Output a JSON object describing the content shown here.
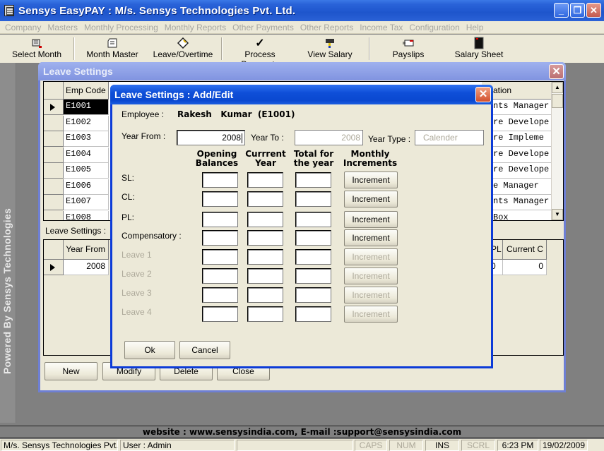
{
  "app": {
    "title": "Sensys EasyPAY : M/s. Sensys Technologies Pvt. Ltd.",
    "window_controls": {
      "minimize": "_",
      "restore": "❐",
      "close": "✕"
    }
  },
  "menu": [
    "Company",
    "Masters",
    "Monthly Processing",
    "Monthly Reports",
    "Other Payments",
    "Other Reports",
    "Income Tax",
    "Configuration",
    "Help"
  ],
  "toolbar": [
    {
      "label": "Select Month",
      "icon": "calendar-flag-icon"
    },
    {
      "label": "Month Master",
      "icon": "notepad-icon"
    },
    {
      "label": "Leave/Overtime",
      "icon": "diamond-tag-icon"
    },
    {
      "label": "Process Payments",
      "icon": "checkmark-icon"
    },
    {
      "label": "View Salary",
      "icon": "projector-icon"
    },
    {
      "label": "Payslips",
      "icon": "payslip-icon"
    },
    {
      "label": "Salary Sheet",
      "icon": "sheet-icon"
    }
  ],
  "banner": "Powered By Sensys Technologies",
  "leave_settings_window": {
    "title": "Leave Settings",
    "close": "✕",
    "employee_grid": {
      "columns": [
        "Emp Code",
        "Designation"
      ],
      "designation_header_visible": "ation",
      "rows": [
        {
          "code": "E1001",
          "designation": "nts Manager",
          "selected": true
        },
        {
          "code": "E1002",
          "designation": "re Develope"
        },
        {
          "code": "E1003",
          "designation": "re Impleme"
        },
        {
          "code": "E1004",
          "designation": "re Develope"
        },
        {
          "code": "E1005",
          "designation": "re Develope"
        },
        {
          "code": "E1006",
          "designation": "e Manager"
        },
        {
          "code": "E1007",
          "designation": "nts Manager"
        },
        {
          "code": "E1008",
          "designation": "Box"
        }
      ]
    },
    "leave_settings_label": "Leave Settings :",
    "settings_grid": {
      "columns": [
        "Year From",
        "PL",
        "Current C"
      ],
      "rows": [
        {
          "year_from": "2008",
          "pl": "0",
          "current": "0"
        }
      ]
    },
    "buttons": [
      {
        "label": "New",
        "accel": "N"
      },
      {
        "label": "Modify",
        "accel": "M"
      },
      {
        "label": "Delete",
        "accel": "D"
      },
      {
        "label": "Close",
        "accel": "C"
      }
    ]
  },
  "dialog": {
    "title": "Leave Settings : Add/Edit",
    "close": "✕",
    "employee_label": "Employee :",
    "employee_name": "Rakesh   Kumar  (E1001)",
    "year_from_label": "Year From :",
    "year_from_value": "2008",
    "year_to_label": "Year To :",
    "year_to_value": "2008",
    "year_type_label": "Year Type :",
    "year_type_value": "Calender",
    "col_headers": [
      {
        "line1": "Opening",
        "line2": "Balances"
      },
      {
        "line1": "Currrent",
        "line2": "Year"
      },
      {
        "line1": "Total for",
        "line2": "the year"
      },
      {
        "line1": "Monthly",
        "line2": "Increments"
      }
    ],
    "rows": [
      {
        "label": "SL:",
        "enabled": true,
        "opening": "",
        "current": "",
        "total": "",
        "button": "Increment"
      },
      {
        "label": "CL:",
        "enabled": true,
        "opening": "",
        "current": "",
        "total": "",
        "button": "Increment"
      },
      {
        "label": "PL:",
        "enabled": true,
        "opening": "",
        "current": "",
        "total": "",
        "button": "Increment"
      },
      {
        "label": "Compensatory :",
        "enabled": true,
        "opening": "",
        "current": "",
        "total": "",
        "button": "Increment"
      },
      {
        "label": "Leave 1",
        "enabled": false,
        "opening": "",
        "current": "",
        "total": "",
        "button": "Increment"
      },
      {
        "label": "Leave 2",
        "enabled": false,
        "opening": "",
        "current": "",
        "total": "",
        "button": "Increment"
      },
      {
        "label": "Leave 3",
        "enabled": false,
        "opening": "",
        "current": "",
        "total": "",
        "button": "Increment"
      },
      {
        "label": "Leave 4",
        "enabled": false,
        "opening": "",
        "current": "",
        "total": "",
        "button": "Increment"
      }
    ],
    "ok_label": "Ok",
    "cancel_label": "Cancel"
  },
  "website_bar": "website : www.sensysindia.com, E-mail :support@sensysindia.com",
  "statusbar": {
    "company": "M/s. Sensys Technologies Pvt. Ltd.",
    "user": "User : Admin",
    "blank": "",
    "caps": "CAPS",
    "num": "NUM",
    "ins": "INS",
    "scrl": "SCRL",
    "time": "6:23 PM",
    "date": "19/02/2009"
  }
}
